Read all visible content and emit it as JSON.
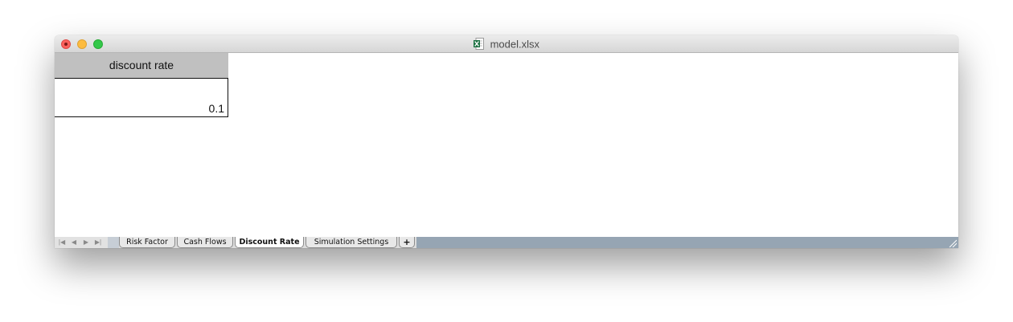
{
  "window": {
    "title": "model.xlsx",
    "file_icon": "excel-file-icon",
    "controls": [
      "close",
      "minimize",
      "zoom"
    ]
  },
  "sheet": {
    "header_label": "discount rate",
    "value": "0.1"
  },
  "tabs": {
    "nav_buttons": [
      "first-sheet",
      "previous-sheet",
      "next-sheet",
      "last-sheet"
    ],
    "items": [
      {
        "label": "Risk Factor",
        "active": false
      },
      {
        "label": "Cash Flows",
        "active": false
      },
      {
        "label": "Discount Rate",
        "active": true
      },
      {
        "label": "Simulation Settings",
        "active": false
      }
    ],
    "add_label": "+"
  },
  "colors": {
    "header_fill": "#c0c0c0",
    "tab_strip": "#96a5b3",
    "close": "#fc605c",
    "minimize": "#fdbc40",
    "zoom": "#34c84a"
  }
}
